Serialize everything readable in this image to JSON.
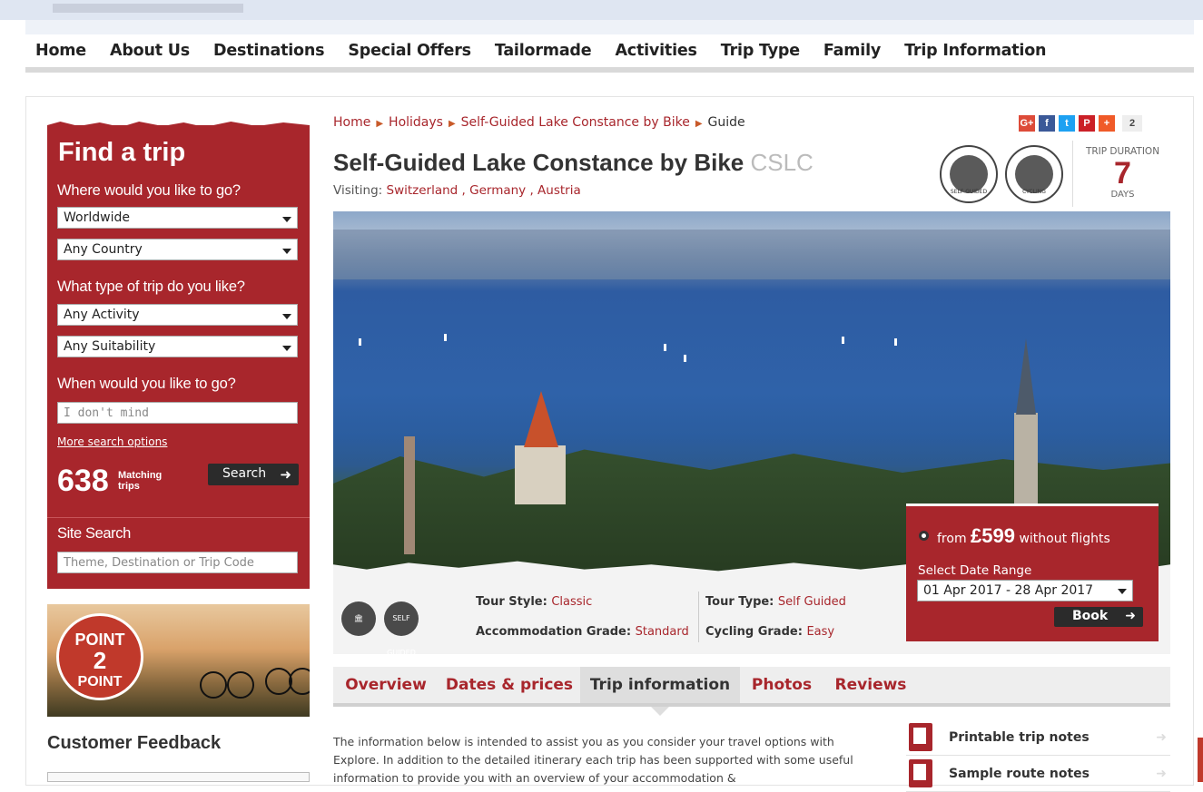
{
  "nav": {
    "items": [
      "Home",
      "About Us",
      "Destinations",
      "Special Offers",
      "Tailormade",
      "Activities",
      "Trip Type",
      "Family",
      "Trip Information"
    ]
  },
  "finder": {
    "title": "Find a trip",
    "where_label": "Where would you like to go?",
    "region_value": "Worldwide",
    "country_value": "Any Country",
    "type_label": "What type of trip do you like?",
    "activity_value": "Any Activity",
    "suitability_value": "Any Suitability",
    "when_label": "When would you like to go?",
    "when_placeholder": "I don't mind",
    "more_link": "More search options",
    "matching_count": "638",
    "matching_label": "Matching trips",
    "search_button": "Search",
    "site_search_label": "Site Search",
    "site_search_placeholder": "Theme, Destination or Trip Code"
  },
  "promo": {
    "line1": "POINT",
    "line2": "2",
    "line3": "POINT"
  },
  "feedback": {
    "title": "Customer Feedback"
  },
  "breadcrumb": [
    "Home",
    "Holidays",
    "Self-Guided Lake Constance by Bike",
    "Guide"
  ],
  "trip": {
    "title": "Self-Guided Lake Constance by Bike",
    "code": "CSLC",
    "visiting_label": "Visiting:",
    "countries": "Switzerland , Germany , Austria",
    "duration_label": "TRIP DURATION",
    "duration_value": "7",
    "duration_unit": "DAYS",
    "icons": [
      "SELF GUIDED",
      "CYCLING"
    ]
  },
  "social": {
    "count": "2",
    "colors": [
      "#dd4b39",
      "#3b5998",
      "#1da1f2",
      "#cb2027",
      "#f05a28"
    ]
  },
  "details": {
    "tour_style_label": "Tour Style:",
    "tour_style": "Classic",
    "accom_label": "Accommodation Grade:",
    "accom": "Standard",
    "tour_type_label": "Tour Type:",
    "tour_type": "Self Guided",
    "cycling_label": "Cycling Grade:",
    "cycling": "Easy",
    "badge_self": "SELF GUIDED"
  },
  "price": {
    "from": "from",
    "amount": "£599",
    "suffix": "without flights",
    "date_range_label": "Select Date Range",
    "date_range_value": "01 Apr 2017 - 28 Apr 2017",
    "book_button": "Book"
  },
  "tabs": [
    "Overview",
    "Dates & prices",
    "Trip information",
    "Photos",
    "Reviews"
  ],
  "body": {
    "text": "The information below is intended to assist you as you consider your travel options with Explore. In addition to the detailed itinerary each trip has been supported with some useful information to provide you with an overview of your accommodation &"
  },
  "notes": [
    "Printable trip notes",
    "Sample route notes"
  ],
  "colors": {
    "brand_red": "#a8262c"
  }
}
